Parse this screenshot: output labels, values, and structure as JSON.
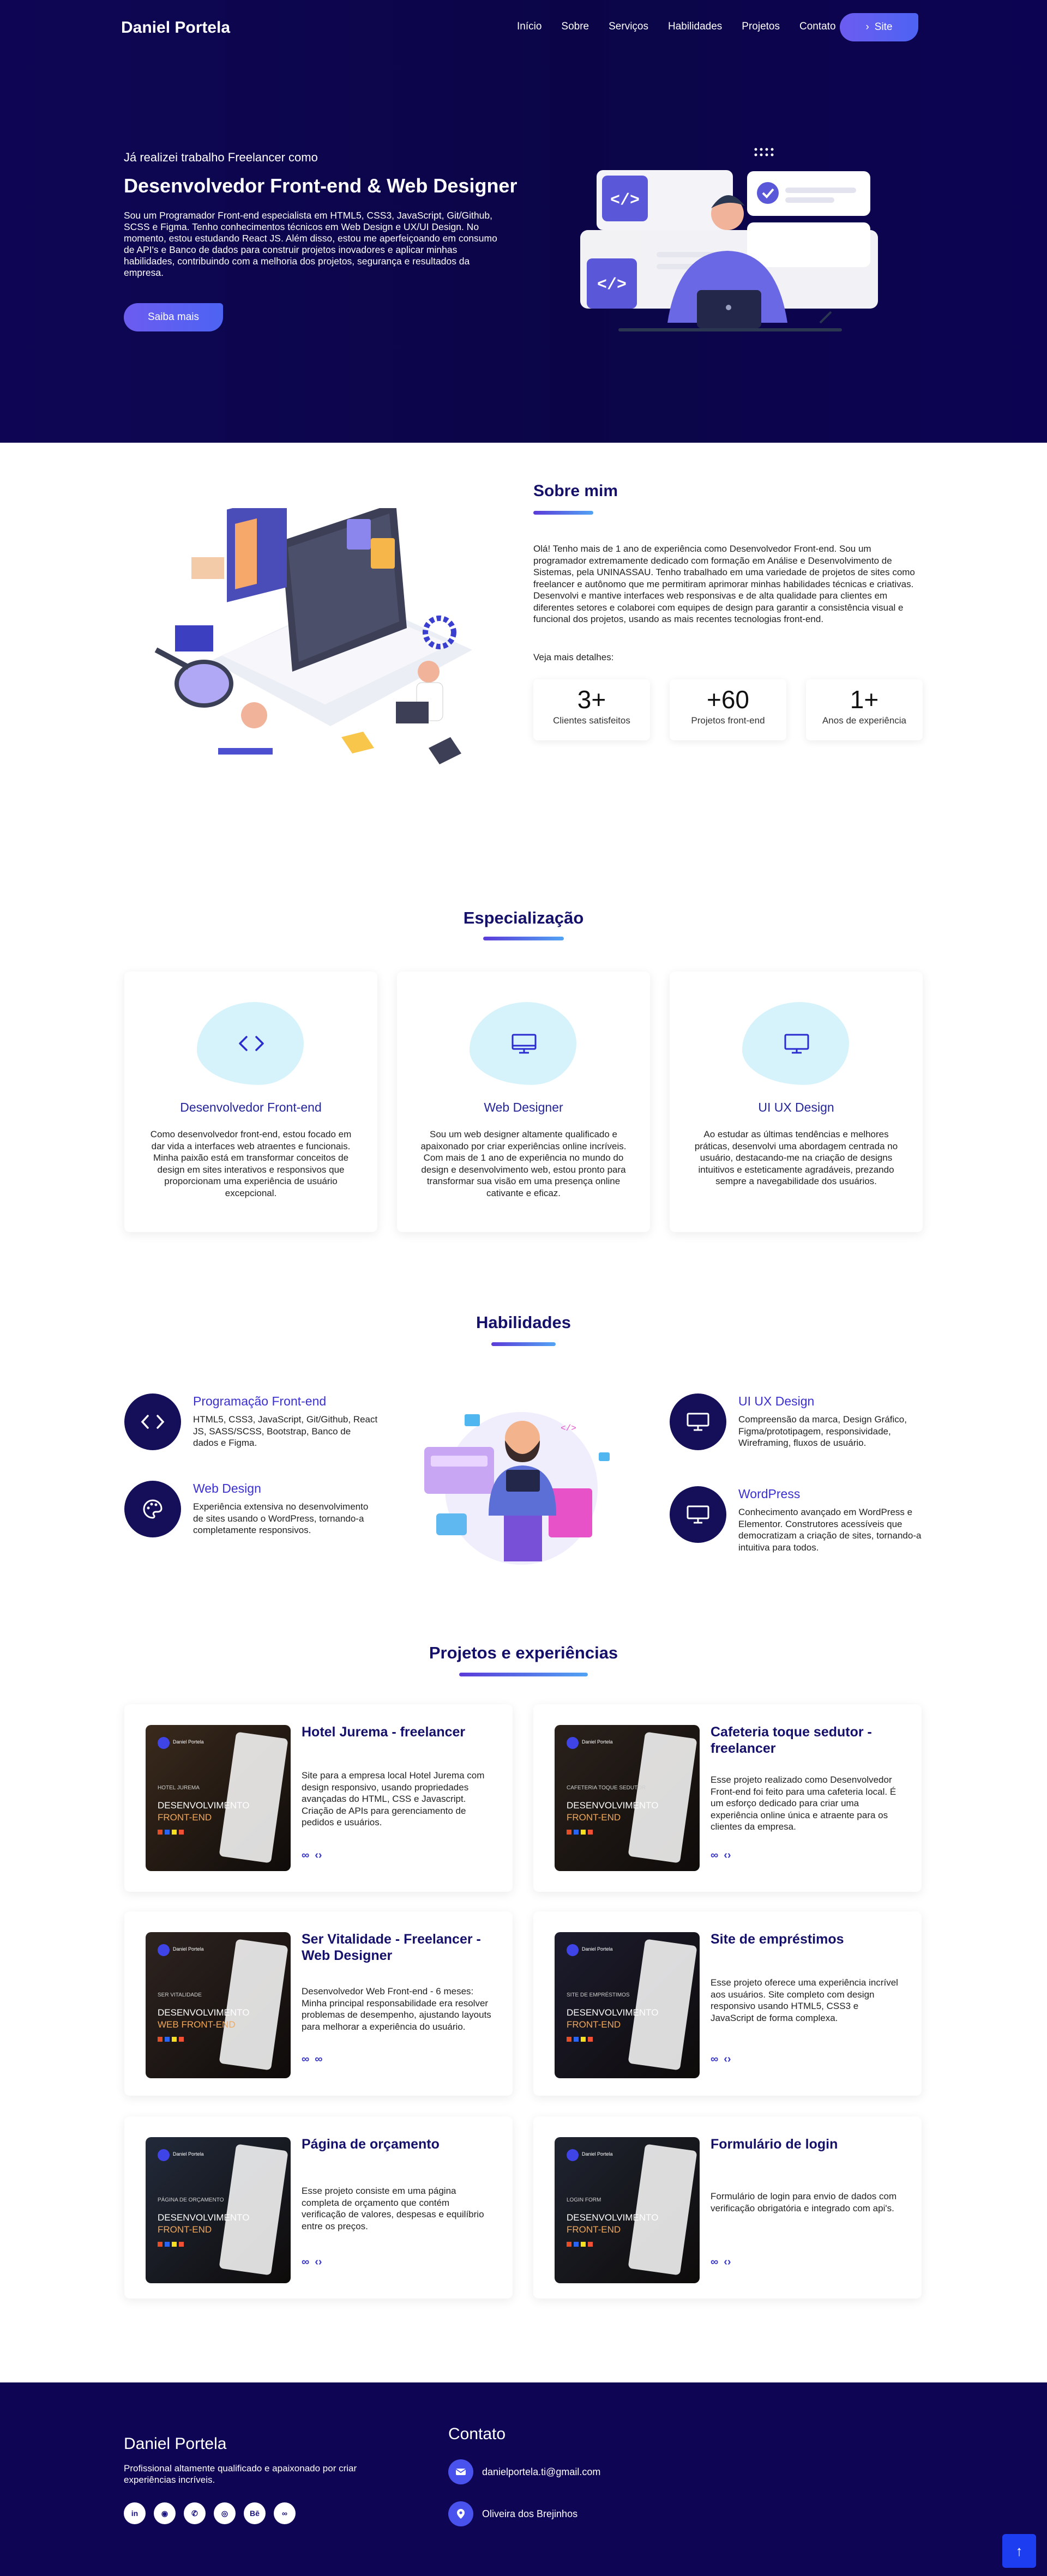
{
  "header": {
    "brand": "Daniel Portela",
    "nav": [
      "Início",
      "Sobre",
      "Serviços",
      "Habilidades",
      "Projetos",
      "Contato"
    ],
    "site_button": "Site"
  },
  "hero": {
    "kicker": "Já realizei trabalho Freelancer como",
    "title": "Desenvolvedor Front-end & Web Designer",
    "text": "Sou um Programador Front-end especialista em HTML5, CSS3, JavaScript, Git/Github, SCSS e Figma. Tenho conhecimentos técnicos em Web Design e UX/UI Design. No momento, estou estudando React JS. Além disso, estou me aperfeiçoando em consumo de API's e Banco de dados para construir projetos inovadores e aplicar minhas habilidades, contribuindo com a melhoria dos projetos, segurança e resultados da empresa.",
    "button": "Saiba mais"
  },
  "about": {
    "title": "Sobre mim",
    "text": "Olá! Tenho mais de 1 ano de experiência como Desenvolvedor Front-end. Sou um programador extremamente dedicado com formação em Análise e Desenvolvimento de Sistemas, pela UNINASSAU. Tenho trabalhado em uma variedade de projetos de sites como freelancer e autônomo que me permitiram aprimorar minhas habilidades técnicas e criativas. Desenvolvi e mantive interfaces web responsivas e de alta qualidade para clientes em diferentes setores e colaborei com equipes de design para garantir a consistência visual e funcional dos projetos, usando as mais recentes tecnologias front-end.",
    "more": "Veja mais detalhes:",
    "stats": [
      {
        "num": "3+",
        "label": "Clientes satisfeitos"
      },
      {
        "num": "+60",
        "label": "Projetos front-end"
      },
      {
        "num": "1+",
        "label": "Anos de experiência"
      }
    ]
  },
  "specialization": {
    "title": "Especialização",
    "cards": [
      {
        "icon": "code-icon",
        "title": "Desenvolvedor Front-end",
        "text": "Como desenvolvedor front-end, estou focado em dar vida a interfaces web atraentes e funcionais. Minha paixão está em transformar conceitos de design em sites interativos e responsivos que proporcionam uma experiência de usuário excepcional."
      },
      {
        "icon": "monitor-icon",
        "title": "Web Designer",
        "text": "Sou um web designer altamente qualificado e apaixonado por criar experiências online incríveis. Com mais de 1 ano de experiência no mundo do design e desenvolvimento web, estou pronto para transformar sua visão em uma presença online cativante e eficaz."
      },
      {
        "icon": "monitor-icon",
        "title": "UI UX Design",
        "text": "Ao estudar as últimas tendências e melhores práticas, desenvolvi uma abordagem centrada no usuário, destacando-me na criação de designs intuitivos e esteticamente agradáveis, prezando sempre a navegabilidade dos usuários."
      }
    ]
  },
  "skills": {
    "title": "Habilidades",
    "items": [
      {
        "icon": "code-icon",
        "title": "Programação Front-end",
        "text": "HTML5, CSS3, JavaScript, Git/Github, React JS, SASS/SCSS, Bootstrap, Banco de dados e Figma."
      },
      {
        "icon": "palette-icon",
        "title": "Web Design",
        "text": "Experiência extensiva no desenvolvimento de sites usando o WordPress, tornando-a completamente responsivos."
      },
      {
        "icon": "monitor-icon",
        "title": "UI UX Design",
        "text": "Compreensão da marca, Design Gráfico, Figma/prototipagem, responsividade, Wireframing, fluxos de usuário."
      },
      {
        "icon": "monitor-icon",
        "title": "WordPress",
        "text": "Conhecimento avançado em WordPress e Elementor. Construtores acessíveis que democratizam a criação de sites, tornando-a intuitiva para todos."
      }
    ]
  },
  "projects": {
    "title": "Projetos e experiências",
    "thumb": {
      "brand": "Daniel Portela",
      "line1": "DESENVOLVIMENTO",
      "line2": "FRONT-END"
    },
    "items": [
      {
        "title": "Hotel Jurema - freelancer",
        "text": "Site para a empresa local Hotel Jurema com design responsivo, usando propriedades avançadas do HTML, CSS e Javascript. Criação de APIs para gerenciamento de pedidos e usuários.",
        "thumb_caption": "HOTEL JUREMA",
        "icons": [
          "link",
          "code"
        ]
      },
      {
        "title": "Cafeteria toque sedutor - freelancer",
        "text": "Esse projeto realizado como Desenvolvedor Front-end foi feito para uma cafeteria local. É um esforço dedicado para criar uma experiência online única e atraente para os clientes da empresa.",
        "thumb_caption": "CAFETERIA TOQUE SEDUTOR",
        "icons": [
          "link",
          "code"
        ]
      },
      {
        "title": "Ser Vitalidade - Freelancer - Web Designer",
        "text": "Desenvolvedor Web Front-end - 6 meses: Minha principal responsabilidade era resolver problemas de desempenho, ajustando layouts para melhorar a experiência do usuário.",
        "thumb_caption": "SER VITALIDADE",
        "thumb_line2": "WEB FRONT-END",
        "icons": [
          "link",
          "link"
        ]
      },
      {
        "title": "Site de empréstimos",
        "text": "Esse projeto oferece uma experiência incrível aos usuários. Site completo com design responsivo usando HTML5, CSS3 e JavaScript de forma complexa.",
        "thumb_caption": "SITE DE EMPRÉSTIMOS",
        "icons": [
          "link",
          "code"
        ]
      },
      {
        "title": "Página de orçamento",
        "text": "Esse projeto consiste em uma página completa de orçamento que contém verificação de valores, despesas e equilíbrio entre os preços.",
        "thumb_caption": "PÁGINA DE ORÇAMENTO",
        "icons": [
          "link",
          "code"
        ]
      },
      {
        "title": "Formulário de login",
        "text": "Formulário de login para envio de dados com verificação obrigatória e integrado com api's.",
        "thumb_caption": "LOGIN FORM",
        "icons": [
          "link",
          "code"
        ]
      }
    ]
  },
  "footer": {
    "name": "Daniel Portela",
    "desc": "Profissional altamente qualificado e apaixonado por criar experiências incríveis.",
    "social": [
      "linkedin-icon",
      "github-icon",
      "whatsapp-icon",
      "instagram-icon",
      "behance-icon",
      "link-icon"
    ],
    "contact_title": "Contato",
    "email": "danielportela.ti@gmail.com",
    "location": "Oliveira dos Brejinhos"
  },
  "colors": {
    "hero_bg": "#0e0654",
    "accent": "#4d63f2",
    "title": "#15106a"
  }
}
